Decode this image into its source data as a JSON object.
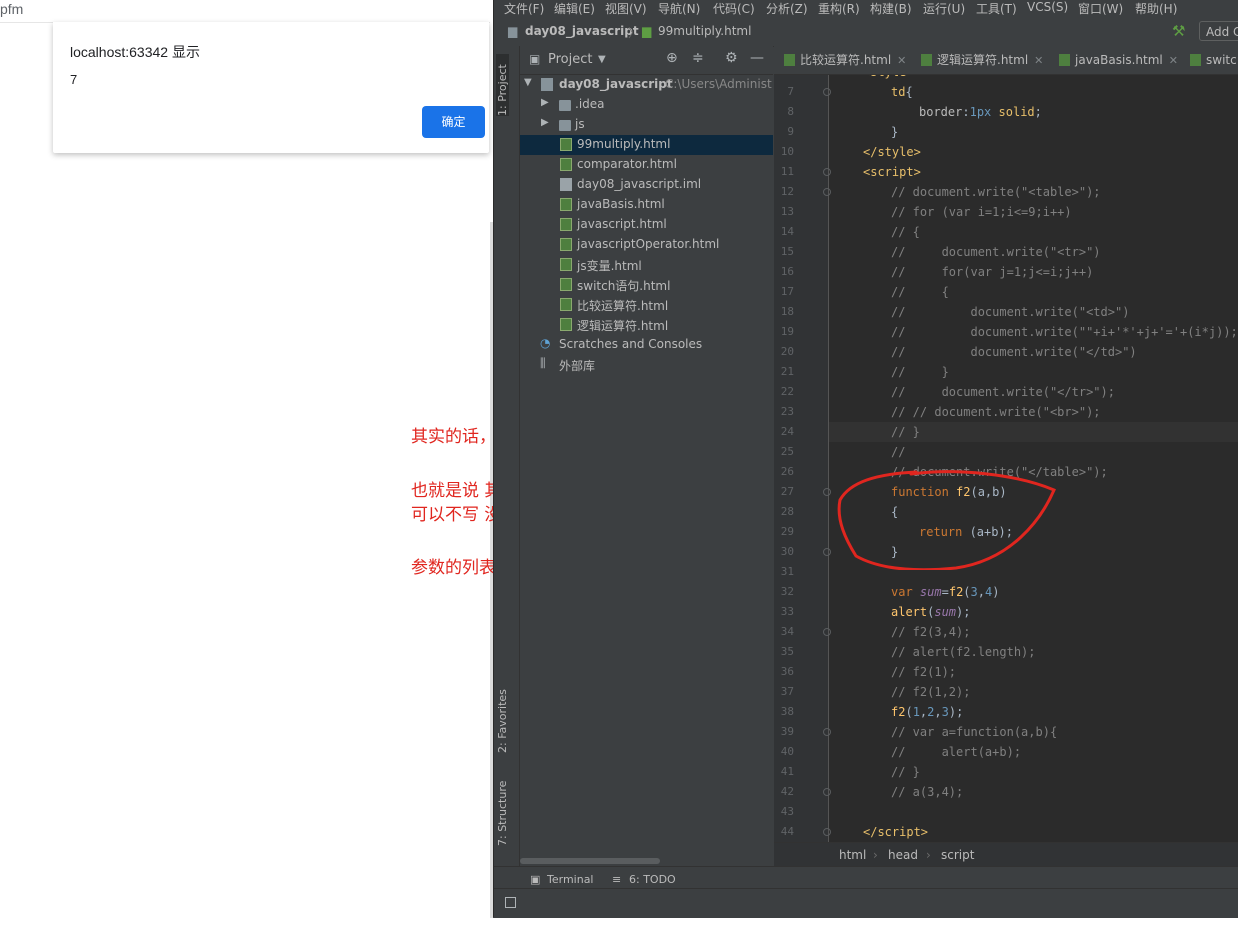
{
  "browser": {
    "address_fragment": "pfm"
  },
  "alert": {
    "title": "localhost:63342 显示",
    "message": "7",
    "ok_label": "确定"
  },
  "annotations": {
    "line1": "其实的话，函数可以有返回值",
    "line2": "也就是说 其实这个js里面的函数很自由 有返回值",
    "line3": "可以不写  没返回值 可以不写",
    "line4": "参数的列表 可以写 部分。"
  },
  "ide": {
    "menu": [
      "文件(F)",
      "编辑(E)",
      "视图(V)",
      "导航(N)",
      "代码(C)",
      "分析(Z)",
      "重构(R)",
      "构建(B)",
      "运行(U)",
      "工具(T)",
      "VCS(S)",
      "窗口(W)",
      "帮助(H)"
    ],
    "nav": {
      "project": "day08_javascript",
      "file": "99multiply.html",
      "add_config": "Add C"
    },
    "left_tool_tabs": {
      "project": "1: Project",
      "favorites": "2: Favorites",
      "structure": "7: Structure"
    },
    "project_panel": {
      "title": "Project",
      "root": "day08_javascript",
      "root_path": "C:\\Users\\Administ",
      "items": [
        {
          "label": ".idea",
          "kind": "folder"
        },
        {
          "label": "js",
          "kind": "folder"
        },
        {
          "label": "99multiply.html",
          "kind": "html",
          "selected": true
        },
        {
          "label": "comparator.html",
          "kind": "html"
        },
        {
          "label": "day08_javascript.iml",
          "kind": "iml"
        },
        {
          "label": "javaBasis.html",
          "kind": "html"
        },
        {
          "label": "javascript.html",
          "kind": "html"
        },
        {
          "label": "javascriptOperator.html",
          "kind": "html"
        },
        {
          "label": "js变量.html",
          "kind": "html"
        },
        {
          "label": "switch语句.html",
          "kind": "html"
        },
        {
          "label": "比较运算符.html",
          "kind": "html"
        },
        {
          "label": "逻辑运算符.html",
          "kind": "html"
        }
      ],
      "scratches": "Scratches and Consoles",
      "external_libs": "外部库"
    },
    "editor_tabs": [
      "比较运算符.html",
      "逻辑运算符.html",
      "javaBasis.html",
      "switc"
    ],
    "breadcrumb": [
      "html",
      "head",
      "script"
    ],
    "bottom_tabs": {
      "terminal": "Terminal",
      "todo": "6: TODO"
    },
    "line_numbers": [
      "7",
      "8",
      "9",
      "10",
      "11",
      "12",
      "13",
      "14",
      "15",
      "16",
      "17",
      "18",
      "19",
      "20",
      "21",
      "22",
      "23",
      "24",
      "25",
      "26",
      "27",
      "28",
      "29",
      "30",
      "31",
      "32",
      "33",
      "34",
      "35",
      "36",
      "37",
      "38",
      "39",
      "40",
      "41",
      "42",
      "43",
      "44"
    ]
  },
  "colors": {
    "annotation_red": "#e0261f",
    "alert_button": "#1a73e8",
    "ide_bg": "#3c3f41",
    "editor_bg": "#2b2b2b"
  }
}
